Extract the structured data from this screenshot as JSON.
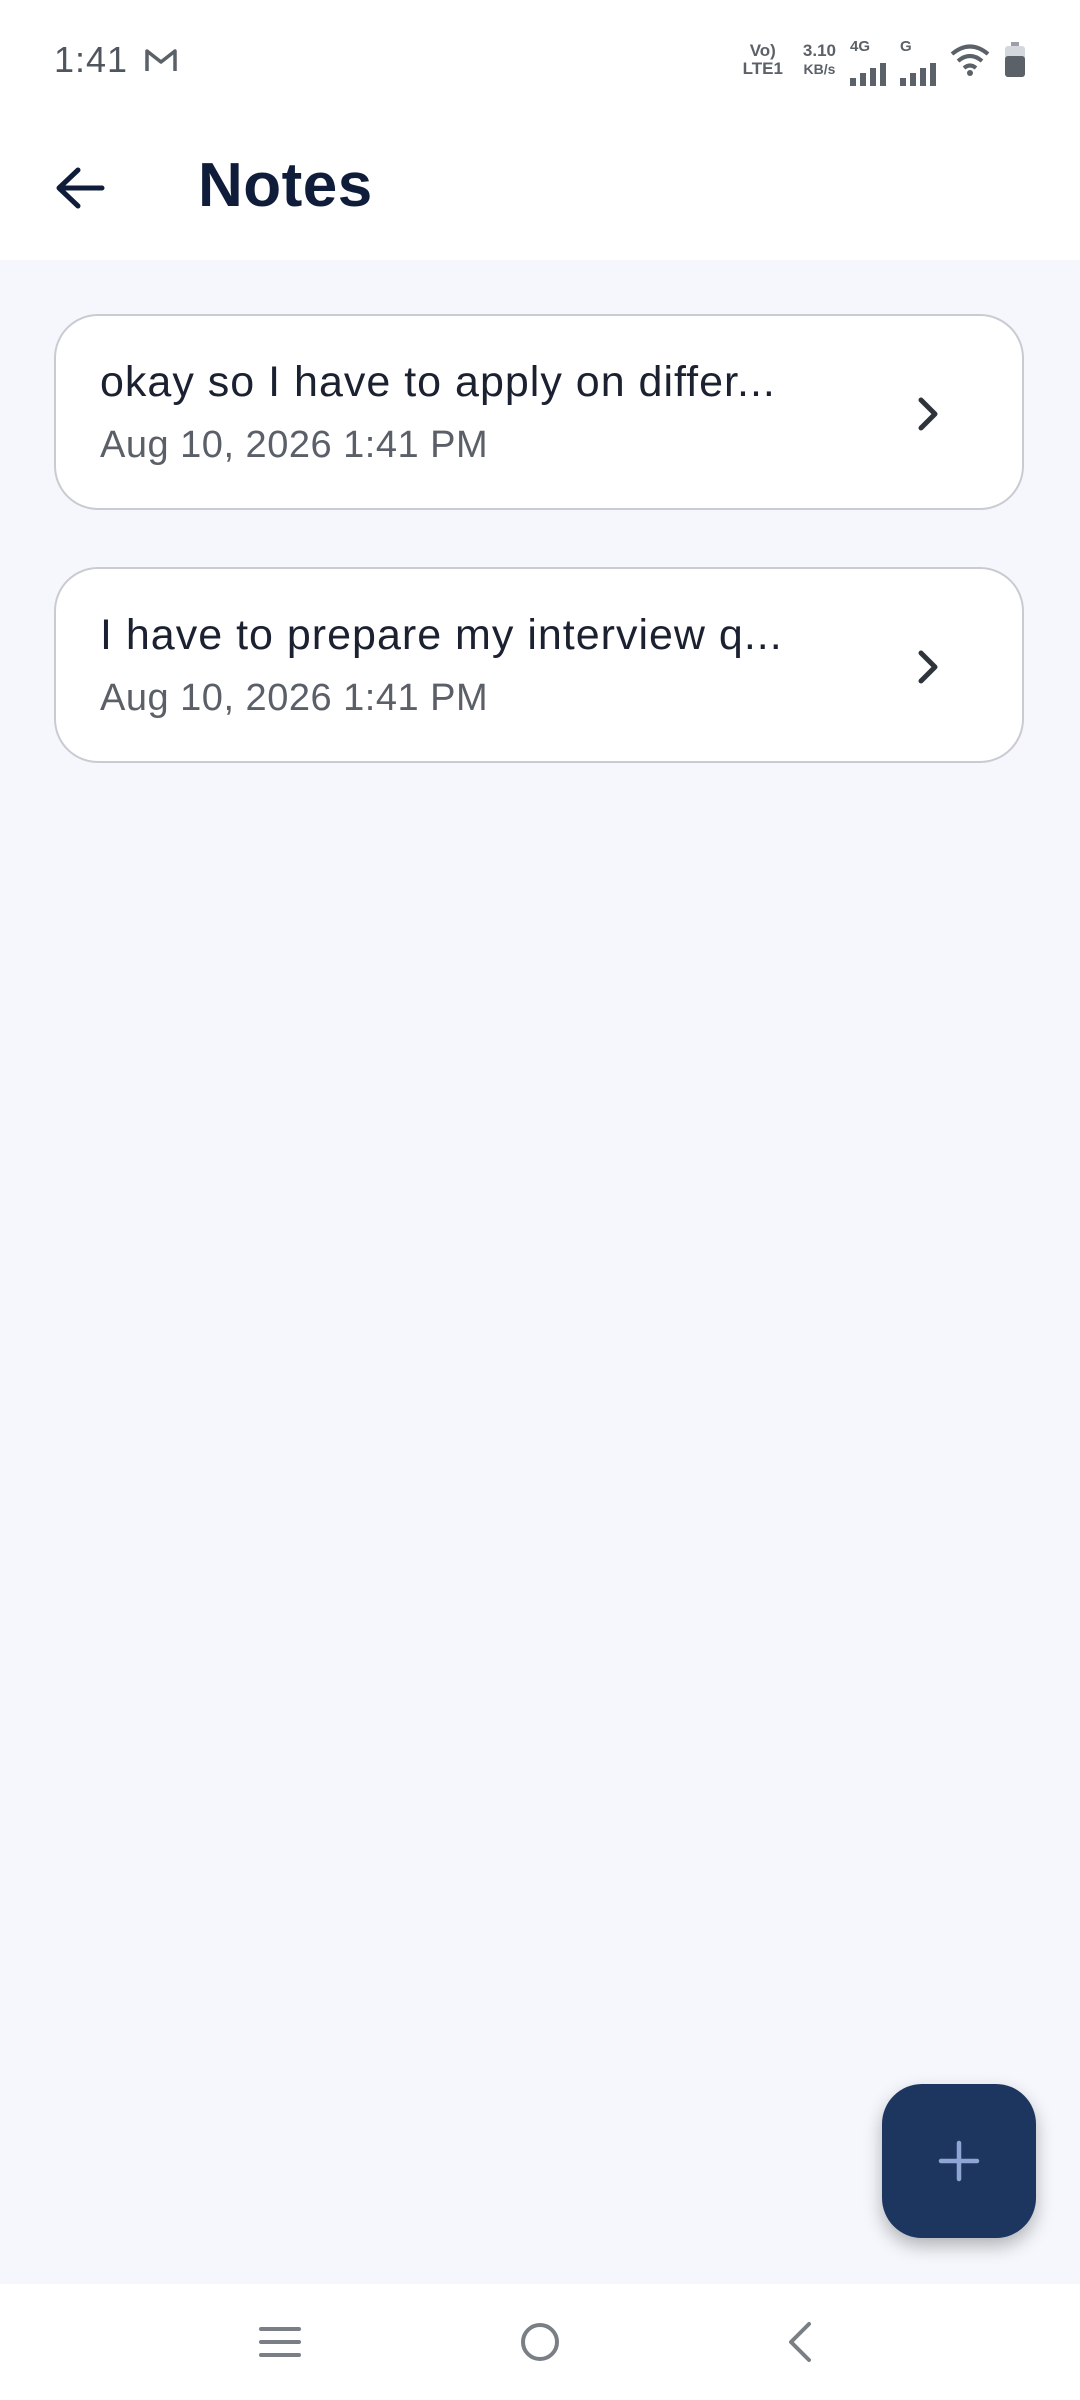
{
  "status_bar": {
    "time": "1:41",
    "volte_top": "Vo)",
    "volte_bottom": "LTE1",
    "speed_value": "3.10",
    "speed_unit": "KB/s",
    "net1": "4G",
    "net2": "G"
  },
  "app_bar": {
    "title": "Notes"
  },
  "notes": [
    {
      "text": "okay so I have to apply on differ...",
      "date": "Aug 10, 2026 1:41 PM"
    },
    {
      "text": "I have to prepare my interview q...",
      "date": "Aug 10, 2026 1:41 PM"
    }
  ],
  "colors": {
    "background": "#f5f7fc",
    "title": "#0f1d3a",
    "fab": "#1d3660",
    "fab_icon": "#8fa6d4"
  },
  "icons": {
    "back": "arrow-left-icon",
    "chevron": "chevron-right-icon",
    "fab": "plus-icon",
    "nav_recents": "menu-icon",
    "nav_home": "circle-icon",
    "nav_back": "chevron-left-icon"
  }
}
